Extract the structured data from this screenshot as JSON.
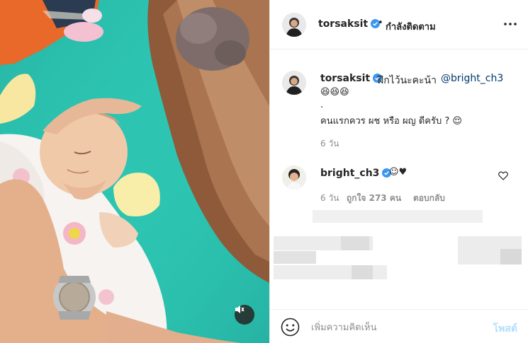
{
  "post": {
    "author": "torsaksit",
    "follow_separator": "•",
    "follow_status": "กำลังติดตาม",
    "media_alt": "baby sleeping on teal blanket while a woman leans over",
    "caption": {
      "username": "torsaksit",
      "text": "ฝึกไว้นะคะน้า",
      "mention": "@bright_ch3",
      "line2": "😆😆😆",
      "line3": ".",
      "line4": "คนแรกควร ผช หรือ ผญ ดีครับ ? 😌",
      "time": "6 วัน"
    },
    "comments": [
      {
        "username": "bright_ch3",
        "text": "☺♥",
        "time": "6 วัน",
        "likes": "ถูกใจ 273 คน",
        "reply": "ตอบกลับ"
      }
    ],
    "comment_placeholder": "เพิ่มความคิดเห็น",
    "post_label": "โพสต์"
  },
  "icons": {
    "verified": "verified-badge-icon",
    "more": "more-options-icon",
    "mute": "volume-muted-icon",
    "emoji": "emoji-smiley-icon",
    "heart": "heart-outline-icon"
  },
  "colors": {
    "verified_blue": "#3897f0",
    "mention_blue": "#00376b",
    "post_disabled": "#b2dffc",
    "blanket_teal": "#2cc6b3"
  }
}
